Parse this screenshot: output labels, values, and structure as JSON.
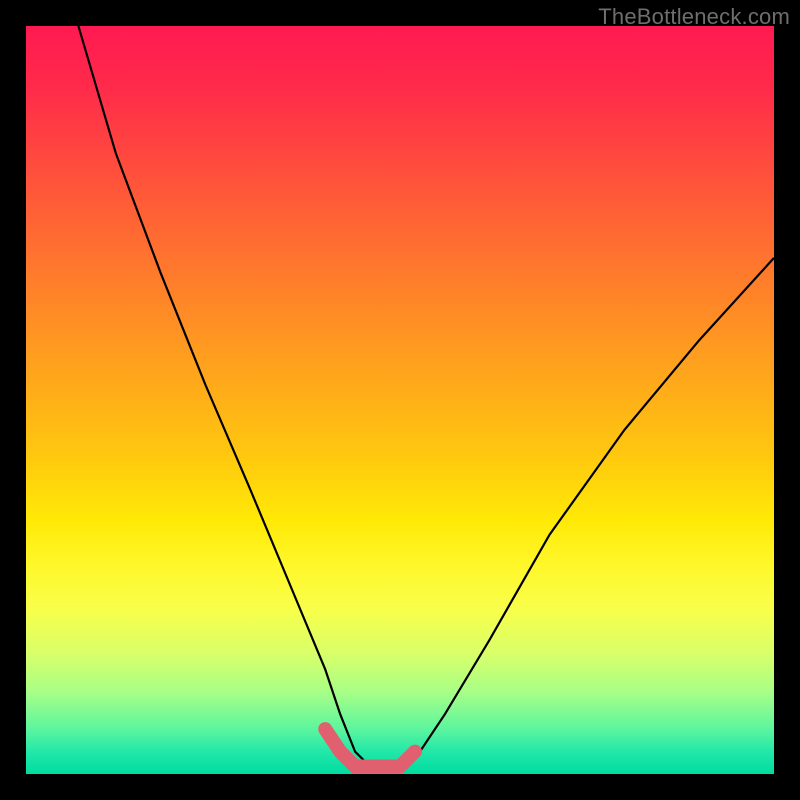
{
  "watermark": "TheBottleneck.com",
  "colors": {
    "frame": "#000000",
    "curve_stroke": "#000000",
    "highlight_stroke": "#e06070",
    "gradient_top": "#ff1a52",
    "gradient_bottom": "#00dca0"
  },
  "chart_data": {
    "type": "line",
    "title": "",
    "xlabel": "",
    "ylabel": "",
    "xlim": [
      0,
      100
    ],
    "ylim": [
      0,
      100
    ],
    "grid": false,
    "legend": false,
    "note": "Values expressed as percentage of plot area; y=0 at bottom, y=100 at top. Curve is a V-shape touching zero near x≈42–52 with a short flat bottom (highlighted).",
    "series": [
      {
        "name": "primary-curve",
        "x": [
          7,
          12,
          18,
          24,
          30,
          35,
          40,
          42,
          44,
          46,
          48,
          50,
          52,
          56,
          62,
          70,
          80,
          90,
          100
        ],
        "y": [
          100,
          83,
          67,
          52,
          38,
          26,
          14,
          8,
          3,
          1,
          1,
          1,
          2,
          8,
          18,
          32,
          46,
          58,
          69
        ]
      },
      {
        "name": "bottom-highlight",
        "x": [
          40,
          42,
          44,
          46,
          48,
          50,
          52
        ],
        "y": [
          6,
          3,
          1,
          1,
          1,
          1,
          3
        ]
      }
    ]
  }
}
